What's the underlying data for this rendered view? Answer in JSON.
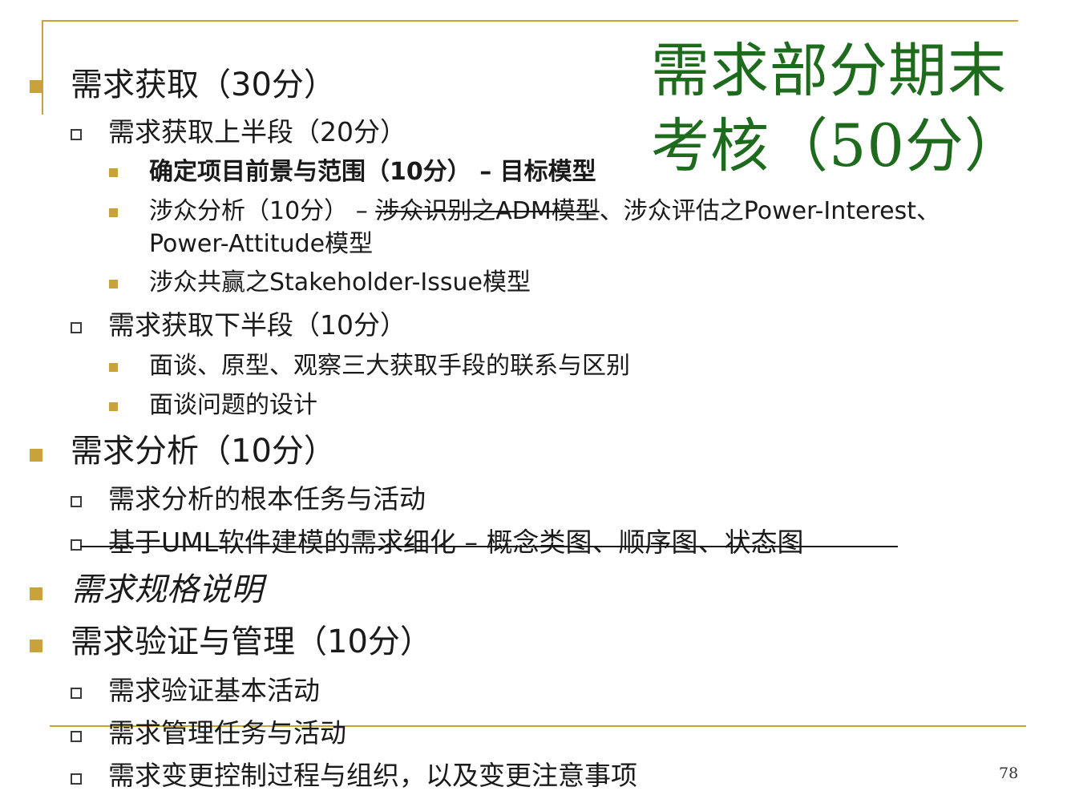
{
  "title": "需求部分期末考核（50分）",
  "items": {
    "elicitation": "需求获取（30分）",
    "elicitation_first": "需求获取上半段（20分）",
    "vision_scope_bold": "确定项目前景与范围（10分） – 目标模型",
    "stakeholder_prefix": "涉众分析（10分） – ",
    "stakeholder_struck": "涉众识别之ADM模型",
    "stakeholder_rest": "、涉众评估之Power-Interest、",
    "stakeholder_line2": "Power-Attitude模型",
    "stakeholder_issue": "涉众共赢之Stakeholder-Issue模型",
    "elicitation_second": "需求获取下半段（10分）",
    "interview_methods": "面谈、原型、观察三大获取手段的联系与区别",
    "interview_design": "面谈问题的设计",
    "analysis": "需求分析（10分）",
    "analysis_tasks": "需求分析的根本任务与活动",
    "uml_refinement": "基于UML软件建模的需求细化 – 概念类图、顺序图、状态图",
    "specification": "需求规格说明",
    "validation_mgmt": "需求验证与管理（10分）",
    "validation_activities": "需求验证基本活动",
    "mgmt_tasks": "需求管理任务与活动",
    "change_control": "需求变更控制过程与组织，以及变更注意事项"
  },
  "page_number": "78",
  "colors": {
    "accent": "#c8a23a",
    "title": "#1e6b1e",
    "text": "#1a1a1a"
  },
  "icons": {
    "level1": "filled-square-bullet",
    "level2": "hollow-square-bullet",
    "level3": "small-filled-square-bullet"
  }
}
